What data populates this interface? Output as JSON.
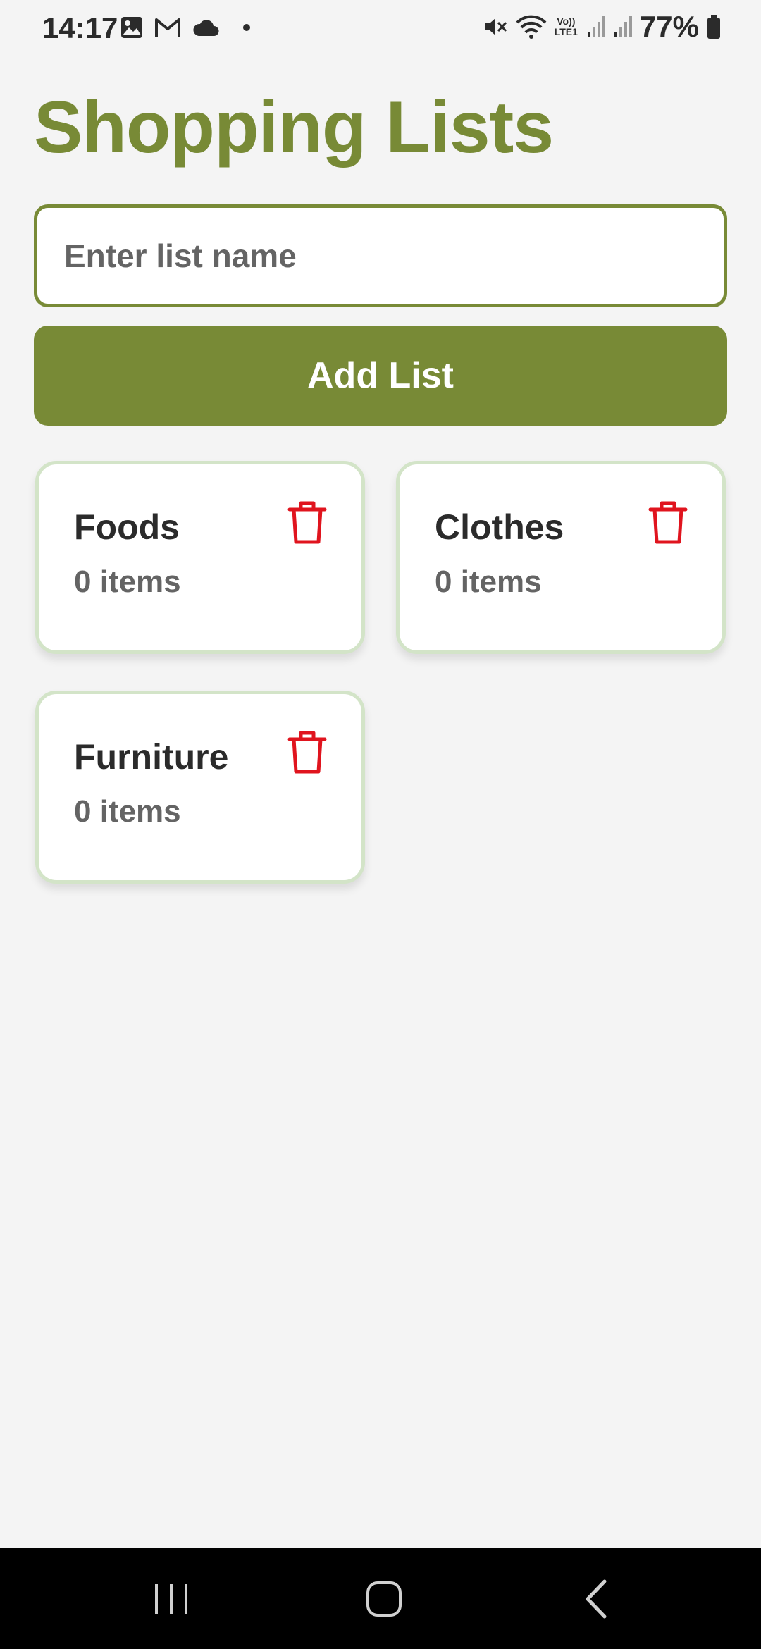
{
  "status_bar": {
    "time": "14:17",
    "battery_percent": "77%",
    "network_label_top": "Vo))",
    "network_label_bottom": "LTE1",
    "icons": [
      "gallery-icon",
      "gmail-icon",
      "cloud-icon",
      "dot-icon",
      "mute-icon",
      "wifi-icon",
      "signal-icon",
      "signal-icon-2",
      "battery-icon"
    ]
  },
  "header": {
    "title": "Shopping Lists"
  },
  "form": {
    "input_placeholder": "Enter list name",
    "input_value": "",
    "add_button_label": "Add List"
  },
  "lists": [
    {
      "name": "Foods",
      "count_label": "0 items"
    },
    {
      "name": "Clothes",
      "count_label": "0 items"
    },
    {
      "name": "Furniture",
      "count_label": "0 items"
    }
  ],
  "nav": {
    "buttons": [
      "recents",
      "home",
      "back"
    ]
  },
  "colors": {
    "accent": "#788a36",
    "background": "#f4f4f4",
    "card_border": "#d3e4c8",
    "delete": "#e0141e",
    "nav_bar": "#000000"
  }
}
